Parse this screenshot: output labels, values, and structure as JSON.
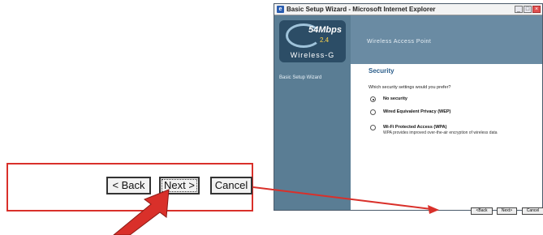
{
  "window": {
    "title": "Basic Setup Wizard - Microsoft Internet Explorer",
    "icon_glyph": "e"
  },
  "logo": {
    "speed": "54Mbps",
    "band": "2.4",
    "name": "Wireless-G"
  },
  "sidebar": {
    "items": [
      {
        "label": "Basic Setup Wizard"
      }
    ]
  },
  "header": {
    "title": "Wireless Access Point"
  },
  "security": {
    "title": "Security",
    "question": "Which security settings would you prefer?",
    "options": [
      {
        "label": "No security",
        "description": "",
        "selected": true
      },
      {
        "label": "Wired Equivalent Privacy (WEP)",
        "description": "",
        "selected": false
      },
      {
        "label": "Wi-Fi Protected Access (WPA)",
        "description": "WPA provides improved over-the-air encryption of wireless data",
        "selected": false
      }
    ]
  },
  "small_buttons": {
    "back": "<Back",
    "next": "Next>",
    "cancel": "Cancel"
  },
  "zoomed_buttons": {
    "back": "< Back",
    "next": "Next >",
    "cancel": "Cancel"
  },
  "colors": {
    "annotation": "#d9302a",
    "sidebar": "#5a7d94",
    "header": "#6a8ba3",
    "title_accent": "#2a5d8a"
  },
  "icons": [
    "ie-icon",
    "minimize-icon",
    "maximize-icon",
    "close-icon",
    "pointer-arrow-icon",
    "connector-arrow-icon"
  ]
}
